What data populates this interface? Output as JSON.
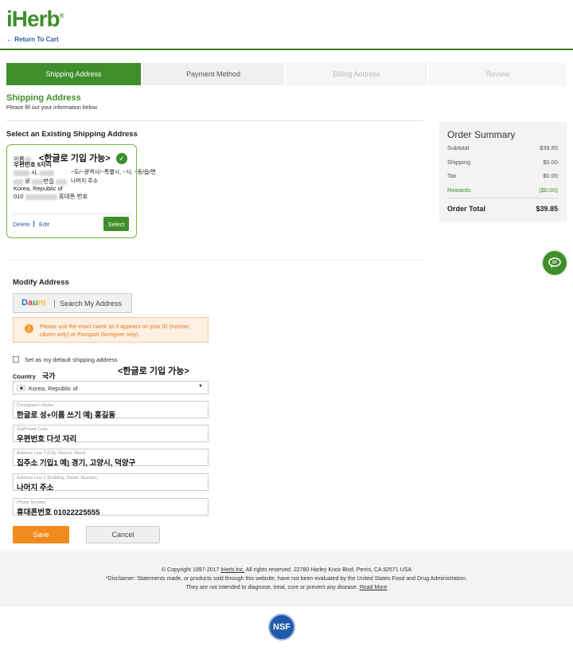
{
  "header": {
    "logo": "iHerb",
    "return_link": "← Return To Cart"
  },
  "steps": [
    "Shipping Address",
    "Payment Method",
    "Billing Address",
    "Review"
  ],
  "section": {
    "title": "Shipping Address",
    "subtitle": "Please fill out your information below",
    "existing_title": "Select an Existing Shipping Address"
  },
  "card": {
    "name_prefix": "이름",
    "annotation": "<한글로 기입 가능>",
    "zip_label": "우편번호 5자리",
    "city_mid": "시,",
    "region_note": "~도/~광역시/~특별시, ~시, ~동/읍/면",
    "road": "로",
    "bunji": "번길",
    "rest_note": "나머지 주소",
    "country": "Korea, Republic of",
    "phone_prefix": "010",
    "phone_note": "휴대폰 번호",
    "delete": "Delete",
    "edit": "Edit",
    "select": "Select"
  },
  "summary": {
    "title": "Order Summary",
    "rows": [
      {
        "label": "Subtotal",
        "value": "$39.85"
      },
      {
        "label": "Shipping",
        "value": "$0.00"
      },
      {
        "label": "Tax",
        "value": "$0.00"
      },
      {
        "label": "Rewards",
        "value": "($0.00)"
      }
    ],
    "total_label": "Order Total",
    "total_value": "$39.85"
  },
  "modify": {
    "title": "Modify Address",
    "daum_label": "Daum",
    "search_label": "Search My Address",
    "warning": "Please use the exact name as it appears on your ID (Korean citizen only) or Passport (foreigner only).",
    "default_label": "Set as my default shipping address",
    "country_label": "Country",
    "country_note": "국가",
    "korean_note": "<한글로 기입 가능>",
    "country_value": "Korea, Republic of"
  },
  "fields": [
    {
      "label": "Consignee's Name",
      "value": "한글로 성+이름 쓰기     예) 홍길동"
    },
    {
      "label": "Zip/Postal Code",
      "value": "우편번호 다섯 자리"
    },
    {
      "label": "Address Line 1 (City, District, Ward)",
      "value": "집주소 기입1       예) 경기, 고양시, 덕양구"
    },
    {
      "label": "Address Line 2 (Building, Street, Number)",
      "value": "나머지 주소"
    },
    {
      "label": "Phone Number",
      "value": "휴대폰번호 01022225555"
    }
  ],
  "buttons": {
    "save": "Save",
    "cancel": "Cancel"
  },
  "footer": {
    "copyright_pre": "© Copyright 1997-2017",
    "company": "iHerb Inc.",
    "copyright_post": "All rights reserved. 22780 Harley Knox Blvd, Perris, CA 92571 USA",
    "disclaimer": "*Disclaimer: Statements made, or products sold through this website, have not been evaluated by the United States Food and Drug Administration.",
    "disclaimer2": "They are not intended to diagnose, treat, cure or prevent any disease.",
    "read_more": "Read More",
    "badge": "NSF"
  },
  "colors": {
    "brand_green": "#3f8e2c",
    "link_blue": "#2a5ca8",
    "save_orange": "#f28b1e",
    "warn_orange": "#e07b1a"
  }
}
